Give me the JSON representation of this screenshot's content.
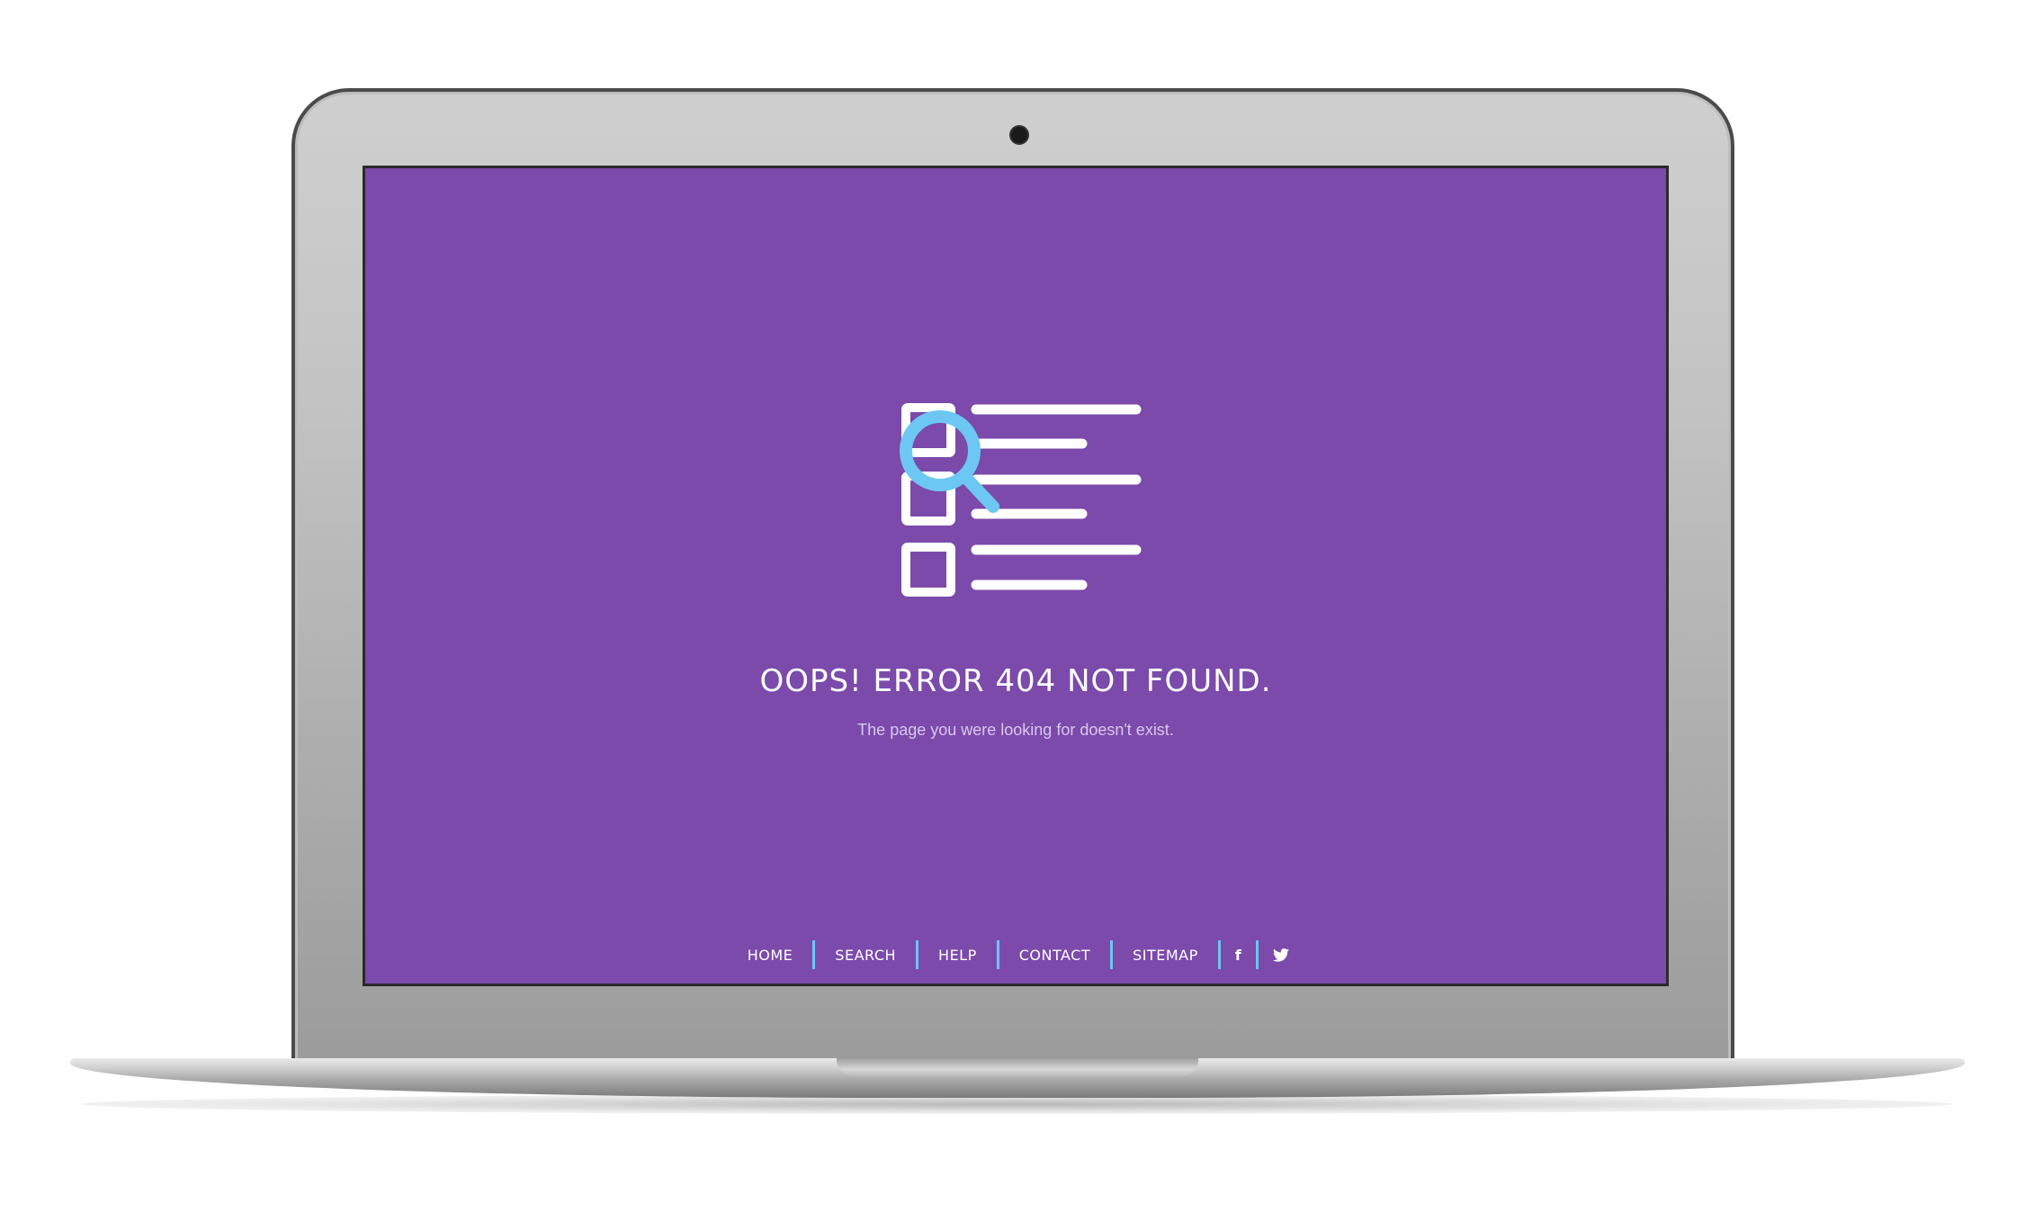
{
  "error": {
    "title": "OOPS! ERROR 404 NOT FOUND.",
    "message": "The page you were looking for doesn't exist."
  },
  "nav": {
    "items": [
      {
        "label": "HOME"
      },
      {
        "label": "SEARCH"
      },
      {
        "label": "HELP"
      },
      {
        "label": "CONTACT"
      },
      {
        "label": "SITEMAP"
      }
    ],
    "social": [
      {
        "label": "f",
        "icon": "facebook-icon"
      },
      {
        "label": "twitter",
        "icon": "twitter-icon"
      }
    ]
  },
  "illustration": {
    "icon": "document-search-icon"
  },
  "colors": {
    "background": "#7b4aab",
    "accent": "#6cc7f2",
    "text": "#ffffff"
  }
}
